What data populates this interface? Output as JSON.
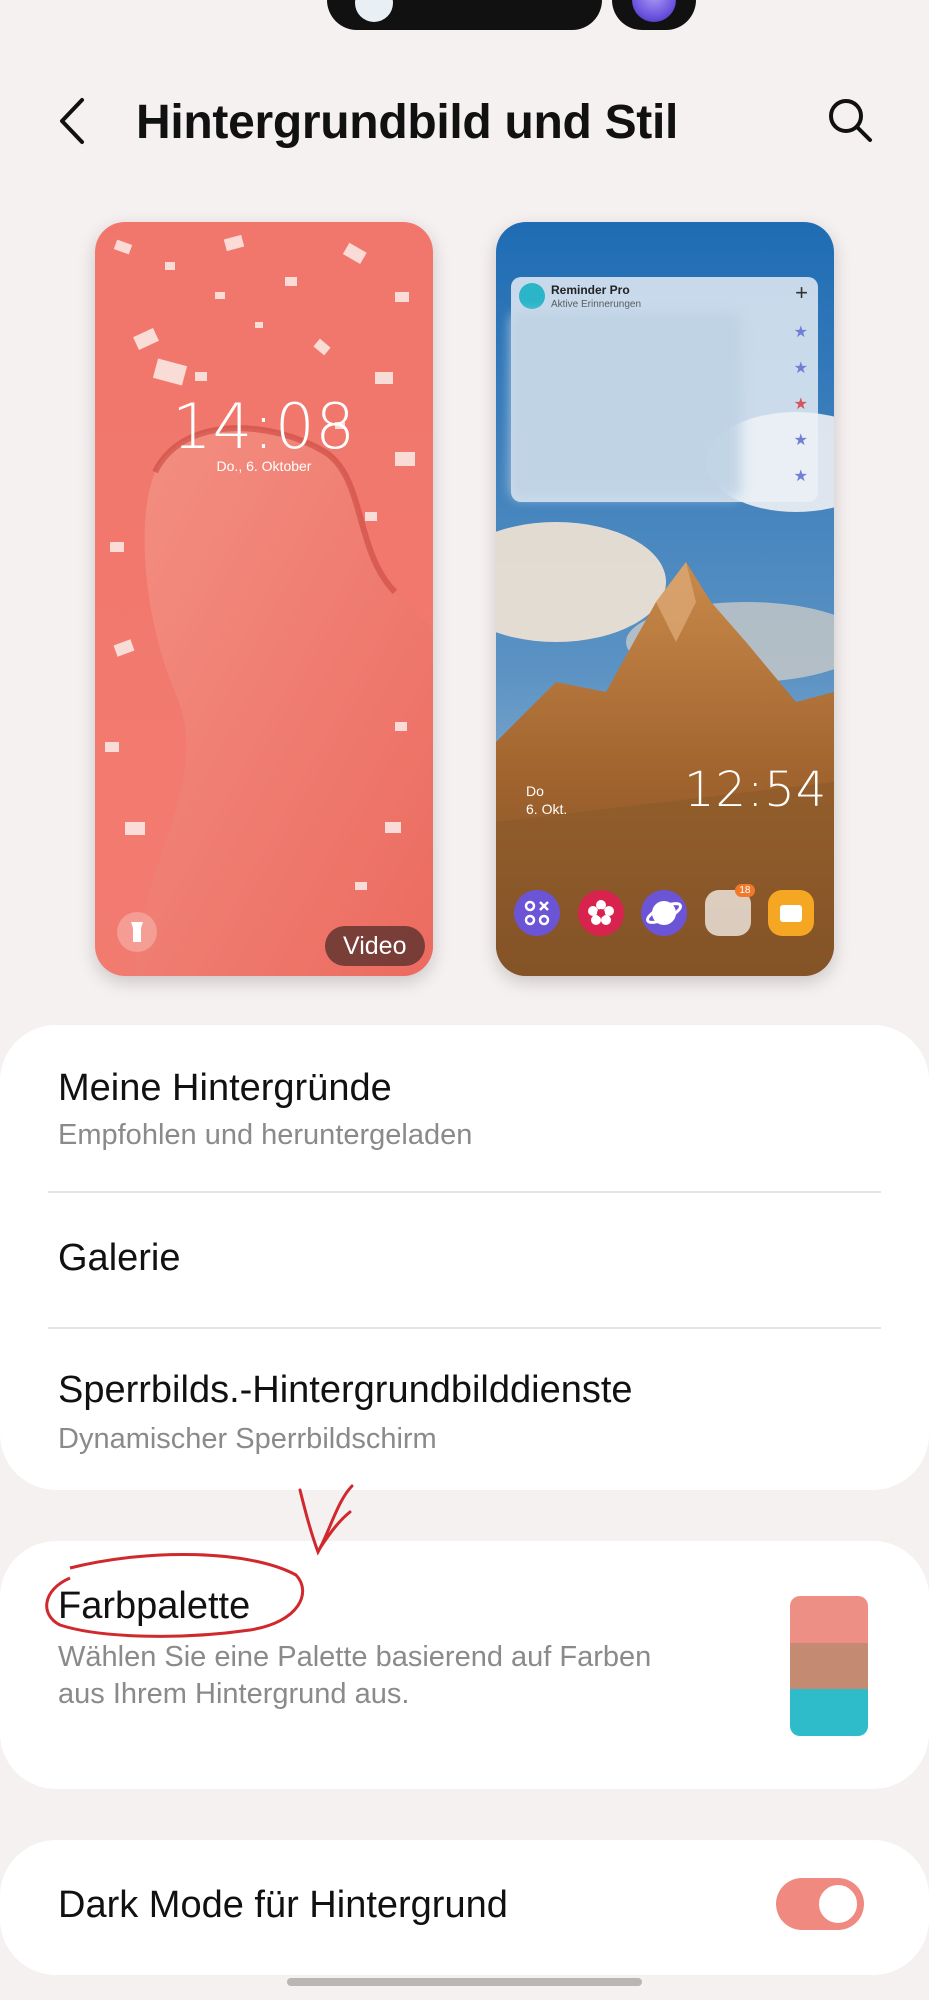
{
  "header": {
    "title": "Hintergrundbild und Stil"
  },
  "previews": {
    "lock": {
      "time": "14:08",
      "date": "Do., 6. Oktober",
      "badge": "Video"
    },
    "home": {
      "widget_title": "Reminder Pro",
      "widget_subtitle": "Aktive Erinnerungen",
      "widget_add": "+",
      "date_line1": "Do",
      "date_line2": "6. Okt.",
      "time": "12:54",
      "folder_badge": "18"
    }
  },
  "menu": {
    "my_wallpapers": {
      "title": "Meine Hintergründe",
      "subtitle": "Empfohlen und heruntergeladen"
    },
    "gallery": {
      "title": "Galerie"
    },
    "lockscreen_services": {
      "title": "Sperrbilds.-Hintergrundbilddienste",
      "subtitle": "Dynamischer Sperrbildschirm"
    }
  },
  "palette": {
    "title": "Farbpalette",
    "subtitle_line1": "Wählen Sie eine Palette basierend auf Farben",
    "subtitle_line2": "aus Ihrem Hintergrund aus.",
    "colors": [
      "#ee8f86",
      "#c48a72",
      "#2fbcca"
    ]
  },
  "dark_mode": {
    "title": "Dark Mode für Hintergrund",
    "enabled": true,
    "accent": "#f08a80"
  },
  "icons": [
    "back-icon",
    "search-icon",
    "flashlight-icon",
    "star-icon"
  ]
}
